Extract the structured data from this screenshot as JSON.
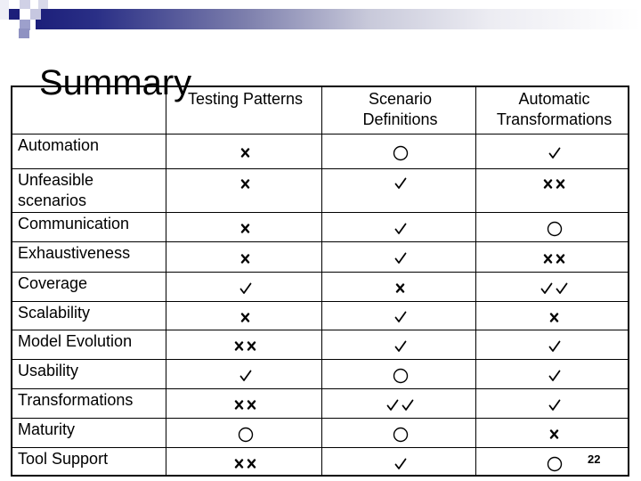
{
  "slide": {
    "title": "Summary",
    "page_number": "22"
  },
  "legend_symbols": {
    "check": "check-mark",
    "double_check": "double-check-mark",
    "cross": "cross-mark",
    "double_cross": "double-cross-mark",
    "circle": "neutral-circle"
  },
  "table": {
    "columns": [
      "",
      "Testing Patterns",
      "Scenario Definitions",
      "Automatic Transformations"
    ],
    "column_lines": [
      [
        "Testing Patterns"
      ],
      [
        "Scenario",
        "Definitions"
      ],
      [
        "Automatic",
        "Transformations"
      ]
    ],
    "rows": [
      {
        "label": "Automation",
        "label_lines": [
          "Automation"
        ],
        "values": [
          "cross",
          "circle",
          "check"
        ]
      },
      {
        "label": "Unfeasible scenarios",
        "label_lines": [
          "Unfeasible",
          "scenarios"
        ],
        "values": [
          "cross",
          "check",
          "double_cross"
        ]
      },
      {
        "label": "Communication",
        "label_lines": [
          "Communication"
        ],
        "values": [
          "cross",
          "check",
          "circle"
        ]
      },
      {
        "label": "Exhaustiveness",
        "label_lines": [
          "Exhaustiveness"
        ],
        "values": [
          "cross",
          "check",
          "double_cross"
        ]
      },
      {
        "label": "Coverage",
        "label_lines": [
          "Coverage"
        ],
        "values": [
          "check",
          "cross",
          "double_check"
        ]
      },
      {
        "label": "Scalability",
        "label_lines": [
          "Scalability"
        ],
        "values": [
          "cross",
          "check",
          "cross"
        ]
      },
      {
        "label": "Model Evolution",
        "label_lines": [
          "Model Evolution"
        ],
        "values": [
          "double_cross",
          "check",
          "check"
        ]
      },
      {
        "label": "Usability",
        "label_lines": [
          "Usability"
        ],
        "values": [
          "check",
          "circle",
          "check"
        ]
      },
      {
        "label": "Transformations",
        "label_lines": [
          "Transformations"
        ],
        "values": [
          "double_cross",
          "double_check",
          "check"
        ]
      },
      {
        "label": "Maturity",
        "label_lines": [
          "Maturity"
        ],
        "values": [
          "circle",
          "circle",
          "cross"
        ]
      },
      {
        "label": "Tool Support",
        "label_lines": [
          "Tool Support"
        ],
        "values": [
          "double_cross",
          "check",
          "circle"
        ]
      }
    ]
  }
}
